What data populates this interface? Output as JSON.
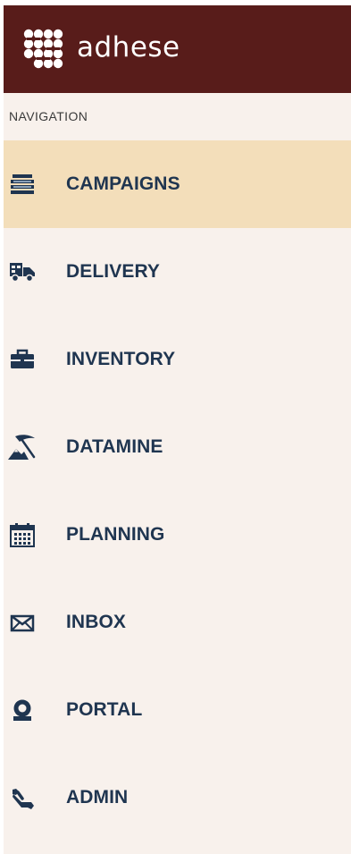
{
  "brand": {
    "name": "adhese",
    "logo_icon": "dots-grid-logo",
    "background": "#581c1a"
  },
  "nav": {
    "heading": "NAVIGATION",
    "active_background": "#f3deba",
    "label_color": "#1f3550",
    "items": [
      {
        "label": "CAMPAIGNS",
        "icon": "campaigns-icon",
        "active": true
      },
      {
        "label": "DELIVERY",
        "icon": "truck-icon",
        "active": false
      },
      {
        "label": "INVENTORY",
        "icon": "briefcase-icon",
        "active": false
      },
      {
        "label": "DATAMINE",
        "icon": "pickaxe-icon",
        "active": false
      },
      {
        "label": "PLANNING",
        "icon": "calendar-icon",
        "active": false
      },
      {
        "label": "INBOX",
        "icon": "envelope-icon",
        "active": false
      },
      {
        "label": "PORTAL",
        "icon": "portal-icon",
        "active": false
      },
      {
        "label": "ADMIN",
        "icon": "wrench-icon",
        "active": false
      }
    ]
  }
}
